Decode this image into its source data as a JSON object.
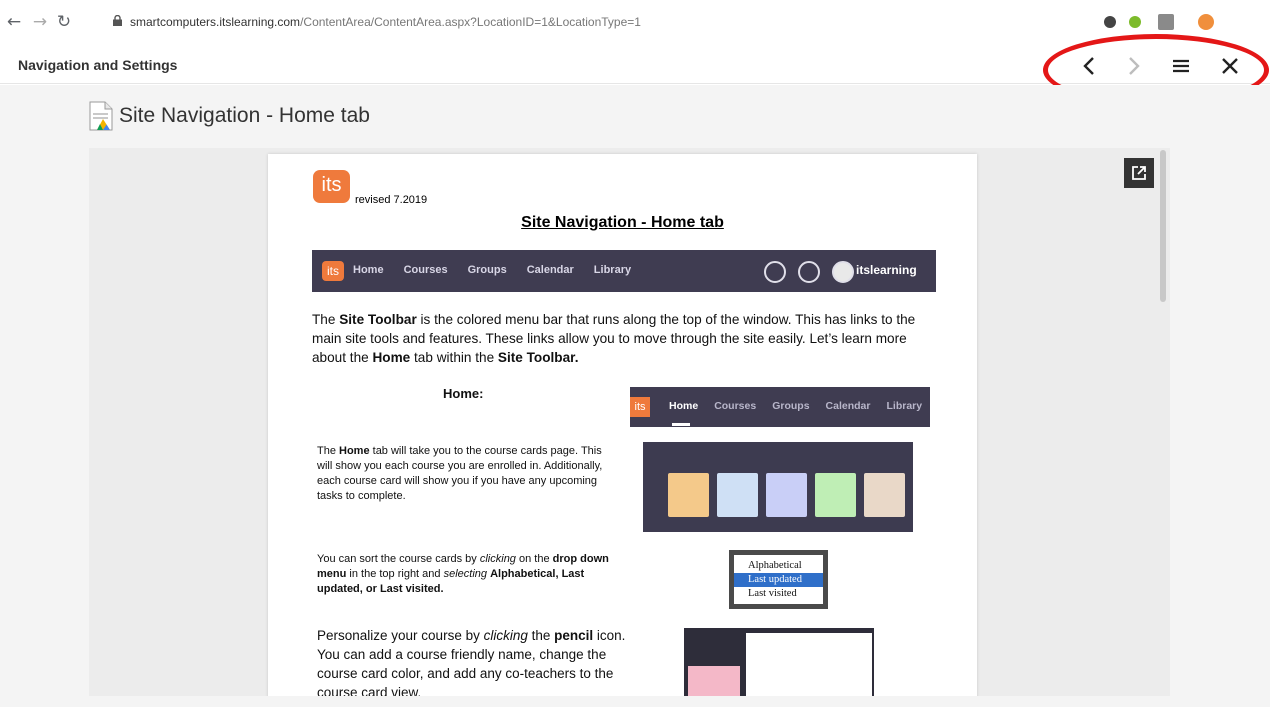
{
  "browser": {
    "url_host": "smartcomputers.itslearning.com",
    "url_path": "/ContentArea/ContentArea.aspx?LocationID=1&LocationType=1"
  },
  "header": {
    "title": "Navigation and Settings",
    "icons": [
      "chevron-left-icon",
      "chevron-right-icon",
      "menu-icon",
      "close-icon"
    ]
  },
  "page": {
    "heading": "Site Navigation - Home tab"
  },
  "document": {
    "logo_text": "its",
    "revised": "revised 7.2019",
    "title": "Site Navigation - Home tab",
    "toolbar": {
      "logo": "its",
      "links": [
        "Home",
        "Courses",
        "Groups",
        "Calendar",
        "Library"
      ],
      "user": "itslearning"
    },
    "intro": {
      "p1": "The ",
      "b1": "Site Toolbar",
      "p2": " is the colored menu bar that runs along the top of the window. This has links to the main site tools and features. These links allow you to move through the site easily. Let’s learn more about the ",
      "b2": "Home",
      "p3": " tab within the ",
      "b3": "Site Toolbar."
    },
    "home_label": "Home:",
    "home_toolbar_links": [
      "Home",
      "Courses",
      "Groups",
      "Calendar",
      "Library"
    ],
    "home_para": {
      "a": "The ",
      "b": "Home",
      "c": " tab will take you to the course cards page. This will show you each course you are enrolled in. Additionally, each course card will show you if you have any upcoming tasks to complete."
    },
    "sort_para": {
      "a": "You can sort the course cards by ",
      "b": "clicking",
      "c": " on the ",
      "d": "drop down menu",
      "e": " in the top right and ",
      "f": "selecting",
      "g": " ",
      "h": "Alphabetical, Last updated, or Last visited."
    },
    "dropdown": [
      "Alphabetical",
      "Last updated",
      "Last visited"
    ],
    "pencil_para": {
      "a": "Personalize your course by ",
      "b": "clicking",
      "c": " the ",
      "d": "pencil",
      "e": " icon. You can add a course friendly name, change the course card color, and add any co-teachers to the course card view."
    }
  },
  "colors": {
    "accent": "#ef7a3c",
    "toolbar": "#3f3c51",
    "highlight": "#e41717"
  }
}
